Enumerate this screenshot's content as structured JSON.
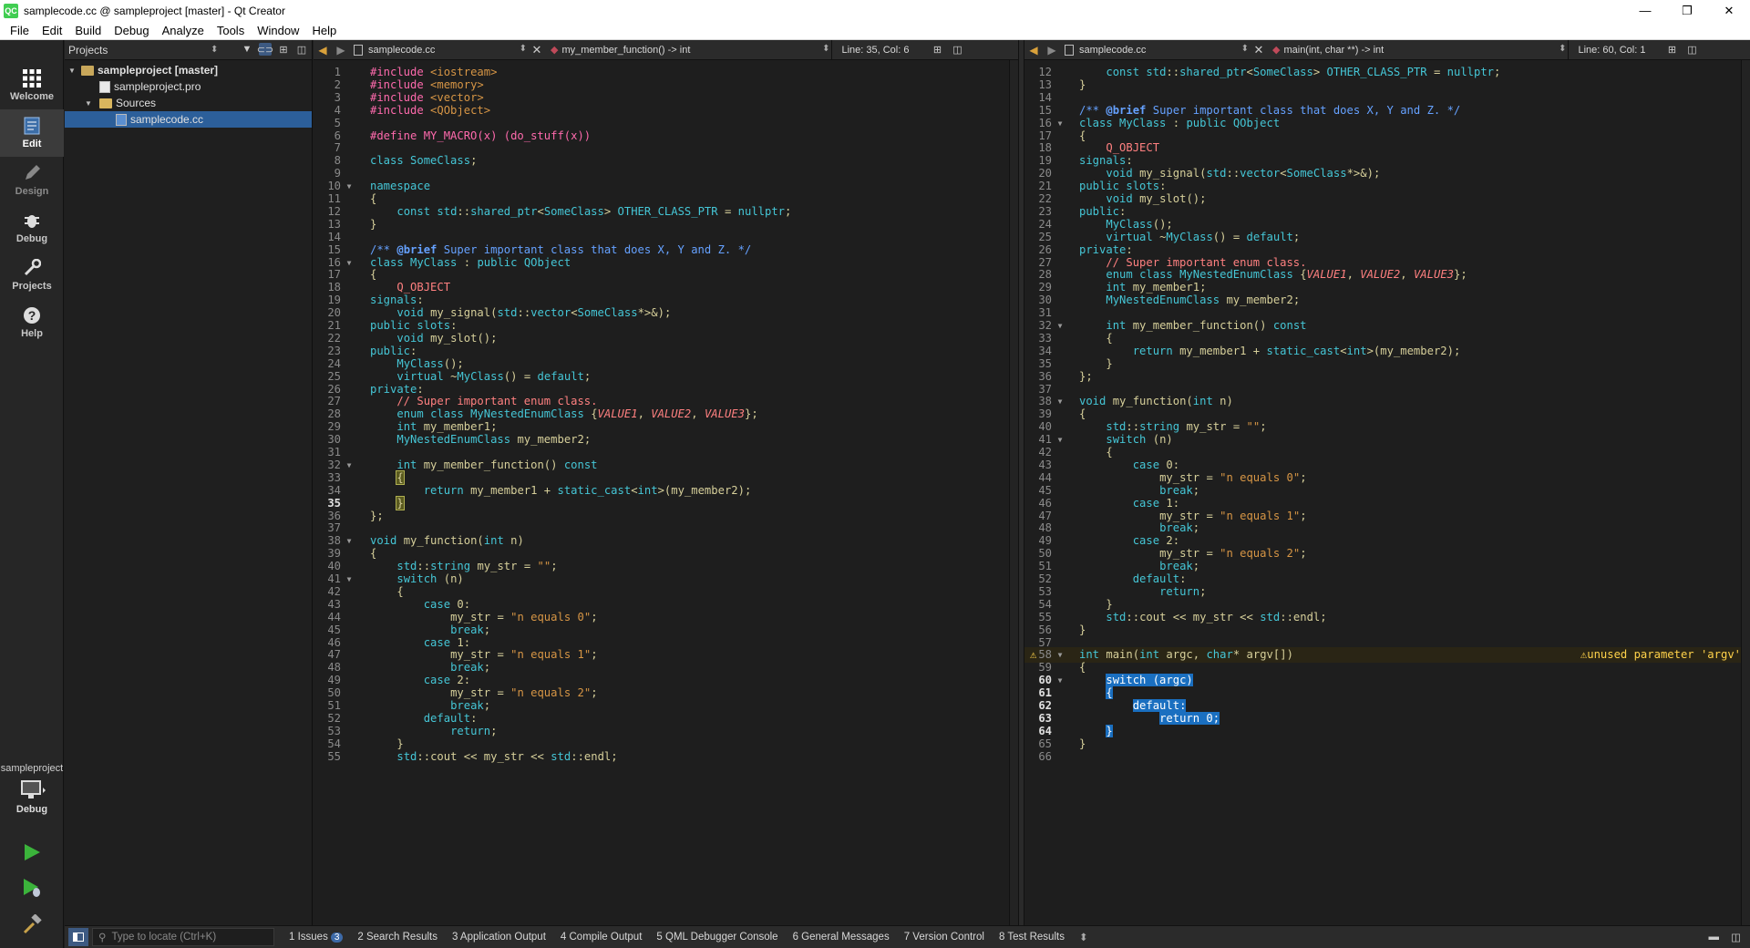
{
  "window": {
    "title": "samplecode.cc @ sampleproject [master] - Qt Creator",
    "logo": "QC"
  },
  "menu": [
    "File",
    "Edit",
    "Build",
    "Debug",
    "Analyze",
    "Tools",
    "Window",
    "Help"
  ],
  "modes": [
    {
      "label": "Welcome",
      "icon": "grid-icon"
    },
    {
      "label": "Edit",
      "icon": "edit-doc-icon"
    },
    {
      "label": "Design",
      "icon": "pencil-icon"
    },
    {
      "label": "Debug",
      "icon": "bug-icon"
    },
    {
      "label": "Projects",
      "icon": "wrench-icon"
    },
    {
      "label": "Help",
      "icon": "help-icon"
    }
  ],
  "kit": {
    "project": "sampleproject",
    "config": "Debug"
  },
  "projects": {
    "header": "Projects",
    "tree": [
      {
        "label": "sampleproject [master]",
        "level": 0,
        "type": "project",
        "expanded": true
      },
      {
        "label": "sampleproject.pro",
        "level": 1,
        "type": "file"
      },
      {
        "label": "Sources",
        "level": 1,
        "type": "folder",
        "expanded": true
      },
      {
        "label": "samplecode.cc",
        "level": 2,
        "type": "file",
        "selected": true
      }
    ]
  },
  "left_editor": {
    "file": "samplecode.cc",
    "symbol": "my_member_function() -> int",
    "position": "Line: 35, Col: 6",
    "current_line": 35
  },
  "right_editor": {
    "file": "samplecode.cc",
    "symbol": "main(int, char **) -> int",
    "position": "Line: 60, Col: 1",
    "current_line": 60,
    "warning": "unused parameter 'argv'"
  },
  "status": {
    "locator_placeholder": "Type to locate (Ctrl+K)",
    "tabs": [
      "1  Issues",
      "2  Search Results",
      "3  Application Output",
      "4  Compile Output",
      "5  QML Debugger Console",
      "6  General Messages",
      "7  Version Control",
      "8  Test Results"
    ],
    "issues_count": "3"
  },
  "code_lines": [
    "#include <iostream>",
    "#include <memory>",
    "#include <vector>",
    "#include <QObject>",
    "",
    "#define MY_MACRO(x) (do_stuff(x))",
    "",
    "class SomeClass;",
    "",
    "namespace",
    "{",
    "    const std::shared_ptr<SomeClass> OTHER_CLASS_PTR = nullptr;",
    "}",
    "",
    "/** @brief Super important class that does X, Y and Z. */",
    "class MyClass : public QObject",
    "{",
    "    Q_OBJECT",
    "signals:",
    "    void my_signal(std::vector<SomeClass*>&);",
    "public slots:",
    "    void my_slot();",
    "public:",
    "    MyClass();",
    "    virtual ~MyClass() = default;",
    "private:",
    "    // Super important enum class.",
    "    enum class MyNestedEnumClass {VALUE1, VALUE2, VALUE3};",
    "    int my_member1;",
    "    MyNestedEnumClass my_member2;",
    "",
    "    int my_member_function() const",
    "    {",
    "        return my_member1 + static_cast<int>(my_member2);",
    "    }",
    "};",
    "",
    "void my_function(int n)",
    "{",
    "    std::string my_str = \"\";",
    "    switch (n)",
    "    {",
    "        case 0:",
    "            my_str = \"n equals 0\";",
    "            break;",
    "        case 1:",
    "            my_str = \"n equals 1\";",
    "            break;",
    "        case 2:",
    "            my_str = \"n equals 2\";",
    "            break;",
    "        default:",
    "            return;",
    "    }",
    "    std::cout << my_str << std::endl;",
    "}",
    "",
    "int main(int argc, char* argv[])",
    "{",
    "    switch (argc)",
    "    {",
    "        default:",
    "            return 0;",
    "    }",
    "}",
    ""
  ]
}
